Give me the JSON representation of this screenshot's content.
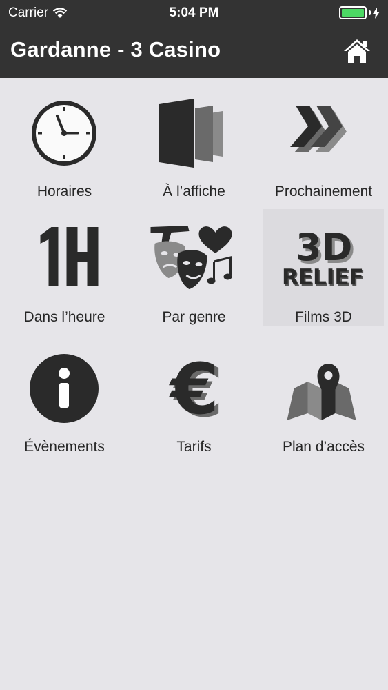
{
  "status_bar": {
    "carrier": "Carrier",
    "time": "5:04 PM",
    "battery_percent": 100,
    "battery_color": "#4cd964"
  },
  "nav": {
    "title": "Gardanne - 3 Casino",
    "home_icon": "home-icon"
  },
  "menu": [
    {
      "label": "Horaires",
      "icon": "clock-icon"
    },
    {
      "label": "À l’affiche",
      "icon": "posters-icon"
    },
    {
      "label": "Prochainement",
      "icon": "chevrons-forward-icon"
    },
    {
      "label": "Dans l’heure",
      "icon": "one-hour-icon"
    },
    {
      "label": "Par genre",
      "icon": "genre-icon"
    },
    {
      "label": "Films 3D",
      "icon": "relief-3d-icon",
      "icon_text_top": "3D",
      "icon_text_bottom": "RELIEF"
    },
    {
      "label": "Évènements",
      "icon": "info-icon"
    },
    {
      "label": "Tarifs",
      "icon": "euro-icon"
    },
    {
      "label": "Plan d’accès",
      "icon": "map-pin-icon"
    }
  ],
  "colors": {
    "bar_background": "#333333",
    "page_background": "#e6e5e9",
    "selected_tile": "#dcdbdf",
    "icon_dark": "#2a2a2a",
    "icon_mid": "#555555",
    "icon_light": "#8a8a8a"
  }
}
